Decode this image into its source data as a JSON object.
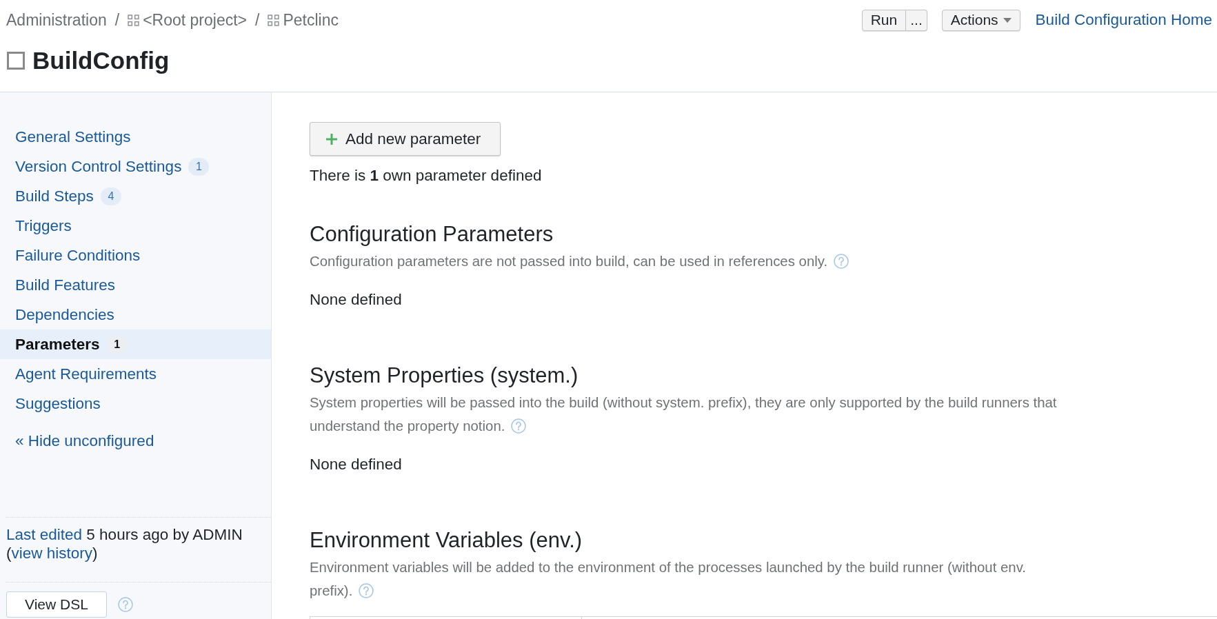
{
  "breadcrumb": [
    {
      "kind": "link",
      "label": "Administration"
    },
    {
      "kind": "separator",
      "label": "/"
    },
    {
      "kind": "project",
      "label": "<Root project>"
    },
    {
      "kind": "separator",
      "label": "/"
    },
    {
      "kind": "project",
      "label": "Petclinc"
    }
  ],
  "toolbar": {
    "run": "Run",
    "more": "...",
    "actions": "Actions",
    "home_link": "Build Configuration Home"
  },
  "title": "BuildConfig",
  "sidebar": {
    "items": [
      {
        "label": "General Settings",
        "selected": false
      },
      {
        "label": "Version Control Settings",
        "count": "1",
        "selected": false
      },
      {
        "label": "Build Steps",
        "count": "4",
        "selected": false
      },
      {
        "label": "Triggers",
        "selected": false
      },
      {
        "label": "Failure Conditions",
        "selected": false
      },
      {
        "label": "Build Features",
        "selected": false
      },
      {
        "label": "Dependencies",
        "selected": false
      },
      {
        "label": "Parameters",
        "count": "1",
        "selected": true
      },
      {
        "label": "Agent Requirements",
        "selected": false
      },
      {
        "label": "Suggestions",
        "selected": false
      }
    ],
    "toggle_link": "« Hide unconfigured",
    "last_edited": [
      {
        "kind": "link",
        "text": "Last edited"
      },
      {
        "kind": "text",
        "text": " 5 hours ago by ADMIN ("
      },
      {
        "kind": "link",
        "text": "view history"
      },
      {
        "kind": "text",
        "text": ")"
      }
    ],
    "dsl_button": "View DSL"
  },
  "main": {
    "add_button": "Add new parameter",
    "summary": "There is **1** own parameter defined",
    "sections": [
      {
        "kind": "empty",
        "title": "Configuration Parameters",
        "description_lines": [
          "Configuration parameters are not passed into build, can be used in references only."
        ],
        "empty_text": "None defined"
      },
      {
        "kind": "empty",
        "title": "System Properties (system.)",
        "description_lines": [
          "System properties will be passed into the build (without system. prefix), they are only supported by the build runners that",
          "understand the property notion."
        ],
        "empty_text": "None defined"
      },
      {
        "kind": "table",
        "title": "Environment Variables (env.)",
        "description_lines": [
          "Environment variables will be added to the environment of the processes launched by the build runner (without env.",
          "prefix)."
        ]
      }
    ]
  }
}
